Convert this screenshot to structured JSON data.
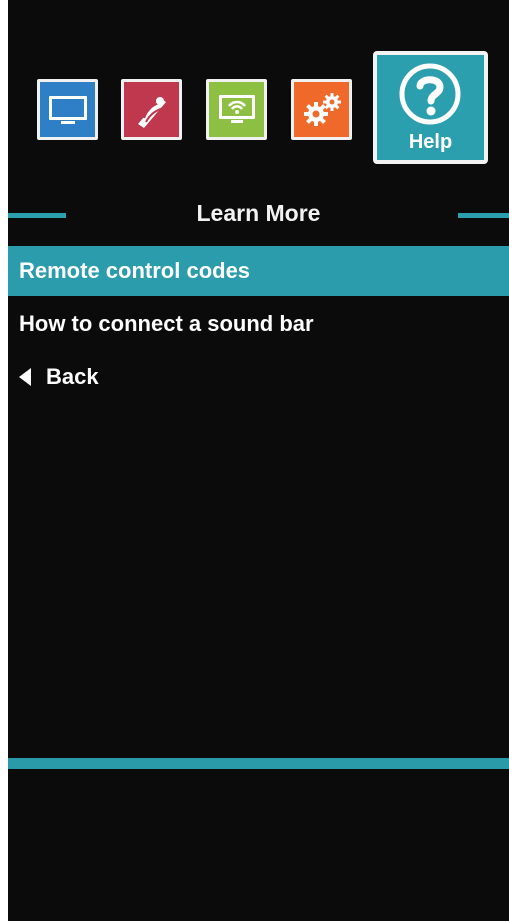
{
  "header": {
    "title": "Learn More"
  },
  "tabs": [
    {
      "id": "tv",
      "icon": "monitor-icon",
      "color": "#2f7fc7"
    },
    {
      "id": "audio",
      "icon": "speaker-icon",
      "color": "#c0384d"
    },
    {
      "id": "network",
      "icon": "network-icon",
      "color": "#8dbf43"
    },
    {
      "id": "settings",
      "icon": "gears-icon",
      "color": "#ef6a2a"
    },
    {
      "id": "help",
      "icon": "help-question-icon",
      "label": "Help",
      "color": "#2c9fae",
      "active": true
    }
  ],
  "menu": {
    "items": [
      {
        "label": "Remote control codes",
        "selected": true
      },
      {
        "label": "How to connect a sound bar",
        "selected": false
      },
      {
        "label": "Back",
        "icon": "back-arrow-icon",
        "selected": false
      }
    ]
  },
  "colors": {
    "accent": "#2b9fae",
    "background": "#0b0b0b"
  }
}
